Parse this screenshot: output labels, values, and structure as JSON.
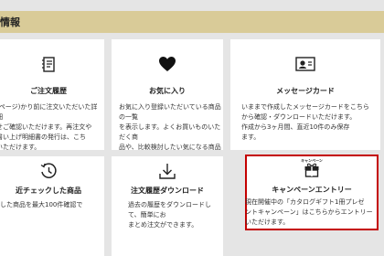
{
  "section": {
    "title": "情報"
  },
  "cards": [
    {
      "title": "ご注文履歴",
      "icon": "order-history-icon",
      "description": "(ページ)かり前に注文いただいた詳細\nせご確認いただけます。再注文や\n書い上げ明細書の発行は、こち\nいただけます。"
    },
    {
      "title": "お気に入り",
      "icon": "heart-icon",
      "description": "お気に入り登録いただいている商品の一覧\nを表示します。よくお買いものいただく商\n品や、比較検討したい気になる商品などを\nご登録いただくと便利にご利用いただけます。"
    },
    {
      "title": "メッセージカード",
      "icon": "message-card-icon",
      "description": "いままで作成したメッセージカードをこちら\nから確認・ダウンロードいただけます。\n作成から3ヶ月間、直近10件のみ保存\nます。"
    },
    {
      "title": "近チェックした商品",
      "icon": "recent-history-icon",
      "description": "した商品を最大100件確認で"
    },
    {
      "title": "注文履歴ダウンロード",
      "icon": "download-icon",
      "description": "過去の履歴をダウンロードして、簡単にお\nまとめ注文ができます。"
    },
    {
      "title": "キャンペーンエントリー",
      "icon": "gift-icon",
      "icon_label": "キャンペーン",
      "description": "現在開催中の「カタログギフト1冊プレゼ\nントキャンペーン」はこちらからエントリー\nいただけます。"
    }
  ],
  "colors": {
    "background": "#e5e5e5",
    "header_band": "#d9cb98",
    "card": "#ffffff",
    "highlight_border": "#c40000"
  }
}
